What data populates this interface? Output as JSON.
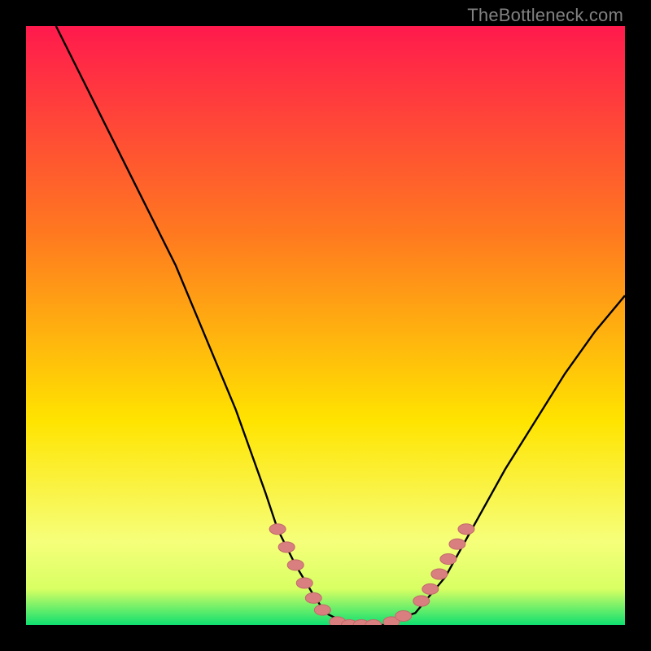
{
  "watermark": "TheBottleneck.com",
  "colors": {
    "frame": "#000000",
    "gradient_top": "#ff1a4d",
    "gradient_mid1": "#ff7a1f",
    "gradient_mid2": "#ffe400",
    "gradient_band": "#f6ff7a",
    "gradient_bottom": "#10e070",
    "curve": "#000000",
    "marker_fill": "#d97f7f",
    "marker_stroke": "#c06a6a"
  },
  "chart_data": {
    "type": "line",
    "title": "",
    "xlabel": "",
    "ylabel": "",
    "xlim": [
      0,
      100
    ],
    "ylim": [
      0,
      100
    ],
    "grid": false,
    "series": [
      {
        "name": "bottleneck-curve",
        "x": [
          5,
          10,
          15,
          20,
          25,
          30,
          35,
          40,
          42,
          45,
          48,
          50,
          52,
          55,
          58,
          60,
          62,
          65,
          70,
          75,
          80,
          85,
          90,
          95,
          100
        ],
        "y": [
          100,
          90,
          80,
          70,
          60,
          48,
          36,
          22,
          16,
          10,
          5,
          2,
          1,
          0,
          0,
          0,
          1,
          2,
          8,
          17,
          26,
          34,
          42,
          49,
          55
        ]
      }
    ],
    "markers": [
      {
        "group": "left-slope",
        "x": 42,
        "y": 16
      },
      {
        "group": "left-slope",
        "x": 43.5,
        "y": 13
      },
      {
        "group": "left-slope",
        "x": 45,
        "y": 10
      },
      {
        "group": "left-slope",
        "x": 46.5,
        "y": 7
      },
      {
        "group": "left-slope",
        "x": 48,
        "y": 4.5
      },
      {
        "group": "left-slope",
        "x": 49.5,
        "y": 2.5
      },
      {
        "group": "valley",
        "x": 52,
        "y": 0.5
      },
      {
        "group": "valley",
        "x": 54,
        "y": 0
      },
      {
        "group": "valley",
        "x": 56,
        "y": 0
      },
      {
        "group": "valley",
        "x": 58,
        "y": 0
      },
      {
        "group": "valley",
        "x": 61,
        "y": 0.5
      },
      {
        "group": "valley",
        "x": 63,
        "y": 1.5
      },
      {
        "group": "right-slope",
        "x": 66,
        "y": 4
      },
      {
        "group": "right-slope",
        "x": 67.5,
        "y": 6
      },
      {
        "group": "right-slope",
        "x": 69,
        "y": 8.5
      },
      {
        "group": "right-slope",
        "x": 70.5,
        "y": 11
      },
      {
        "group": "right-slope",
        "x": 72,
        "y": 13.5
      },
      {
        "group": "right-slope",
        "x": 73.5,
        "y": 16
      }
    ]
  }
}
